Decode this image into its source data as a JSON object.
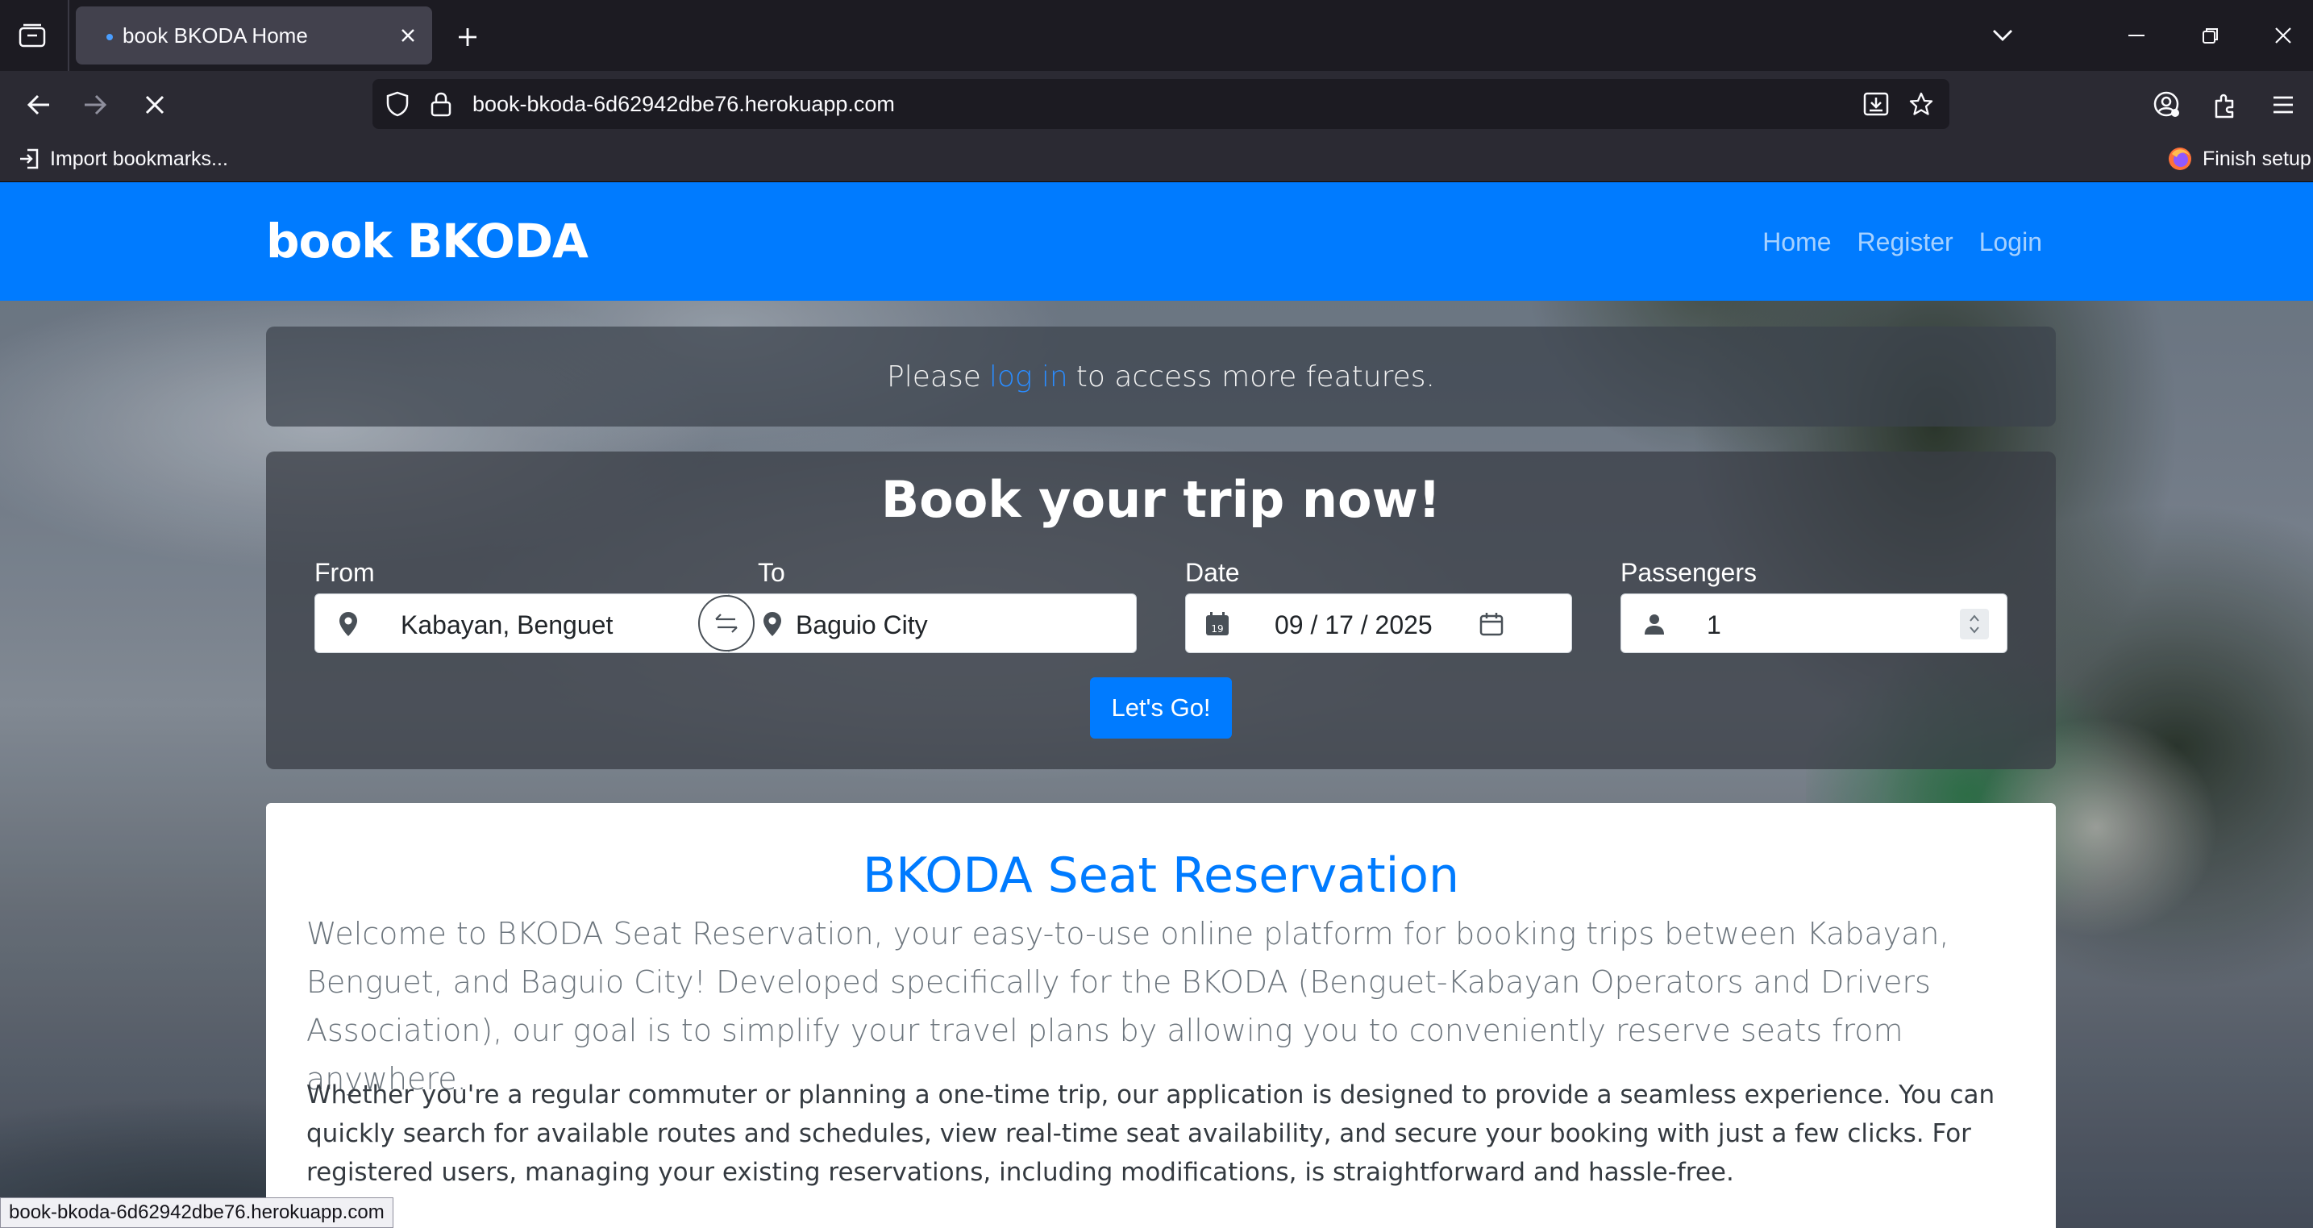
{
  "browser": {
    "tab_title": "book BKODA Home",
    "url": "book-bkoda-6d62942dbe76.herokuapp.com",
    "bookmarks": {
      "import_label": "Import bookmarks...",
      "finish_label": "Finish setup"
    },
    "status_url": "book-bkoda-6d62942dbe76.herokuapp.com"
  },
  "site": {
    "brand": "book BKODA",
    "nav": {
      "home": "Home",
      "register": "Register",
      "login": "Login"
    },
    "brand_color": "#007bff"
  },
  "alert": {
    "before": "Please",
    "link": "log in",
    "after": "to access more features."
  },
  "booking": {
    "title": "Book your trip now!",
    "from_label": "From",
    "from_value": "Kabayan, Benguet",
    "to_label": "To",
    "to_value": "Baguio City",
    "date_label": "Date",
    "date_value": "09 / 17 / 2025",
    "calendar_day": "19",
    "passengers_label": "Passengers",
    "passengers_value": "1",
    "submit_label": "Let's Go!"
  },
  "card": {
    "title": "BKODA Seat Reservation",
    "lead": "Welcome to BKODA Seat Reservation, your easy-to-use online platform for booking trips between Kabayan, Benguet, and Baguio City! Developed specifically for the BKODA (Benguet-Kabayan Operators and Drivers Association), our goal is to simplify your travel plans by allowing you to conveniently reserve seats from anywhere.",
    "body": "Whether you're a regular commuter or planning a one-time trip, our application is designed to provide a seamless experience. You can quickly search for available routes and schedules, view real-time seat availability, and secure your booking with just a few clicks. For registered users, managing your existing reservations, including modifications, is straightforward and hassle-free."
  }
}
